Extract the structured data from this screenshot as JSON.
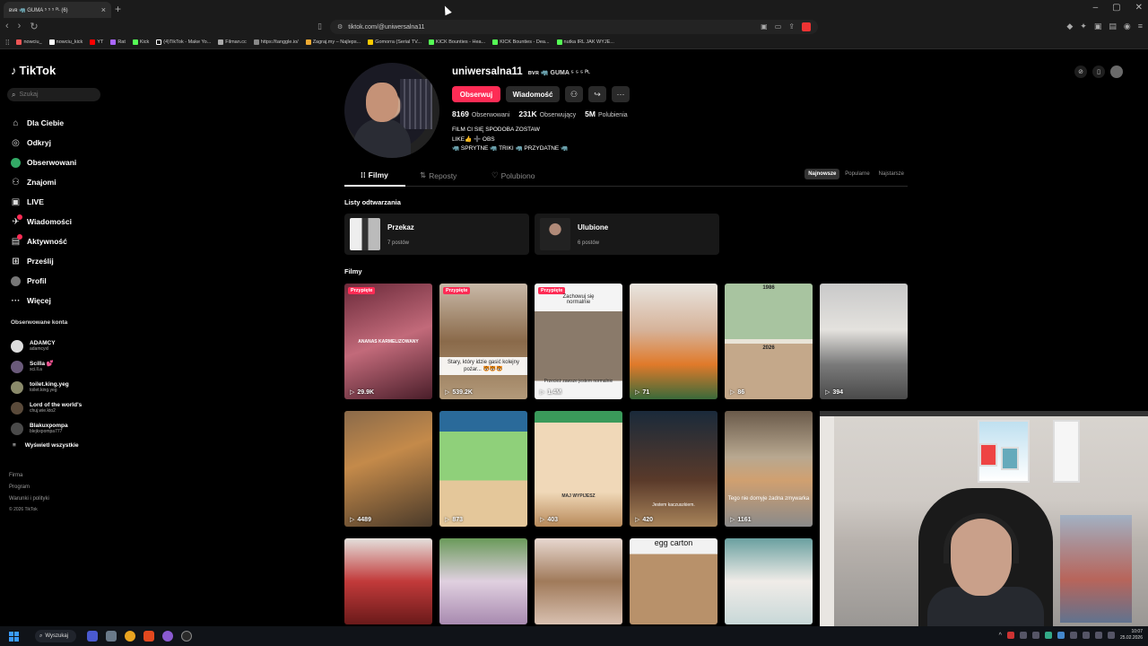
{
  "browser": {
    "tab_title": "ʙᴠʀ 🦏 GUMA ⁵ ⁵ ⁵ ᴾᴸ (6)",
    "url": "tiktok.com/@uniwersalna11",
    "bookmarks": [
      "nowciu_",
      "nowciu_kick",
      "YT",
      "Rat",
      "Kick",
      "(4)TikTok - Make Yo...",
      "Filman.cc",
      "https://tanggle.io/",
      "Zagraj.my – Najleps...",
      "Gomorra (Serial TV...",
      "KICK Bounties - Hea...",
      "KICK Bounties - Dea...",
      "nutka IRL JAK WYJE..."
    ]
  },
  "sidebar": {
    "logo": "TikTok",
    "search_placeholder": "Szukaj",
    "nav": [
      {
        "label": "Dla Ciebie",
        "icon": "home-icon"
      },
      {
        "label": "Odkryj",
        "icon": "compass-icon"
      },
      {
        "label": "Obserwowani",
        "icon": "avatar-icon"
      },
      {
        "label": "Znajomi",
        "icon": "friends-icon"
      },
      {
        "label": "LIVE",
        "icon": "live-icon"
      },
      {
        "label": "Wiadomości",
        "icon": "messages-icon",
        "badge": "12"
      },
      {
        "label": "Aktywność",
        "icon": "inbox-icon"
      },
      {
        "label": "Prześlij",
        "icon": "upload-icon"
      },
      {
        "label": "Profil",
        "icon": "profile-icon"
      },
      {
        "label": "Więcej",
        "icon": "more-icon"
      }
    ],
    "followed_title": "Obserwowane konta",
    "followed": [
      {
        "name": "ADAMCY",
        "handle": "adamcyxl"
      },
      {
        "name": "Scilla 💕",
        "handle": "sci.ll.a"
      },
      {
        "name": "toilet.king.yeg",
        "handle": "toilet.king.yeg"
      },
      {
        "name": "Lord of the world's",
        "handle": "chuj.wie.kto2"
      },
      {
        "name": "Blakuxpompa",
        "handle": "blejkxpompa777"
      }
    ],
    "show_all": "Wyświetl wszystkie",
    "footer": [
      "Firma",
      "Program",
      "Warunki i polityki",
      "© 2026 TikTok"
    ]
  },
  "profile": {
    "username": "uniwersalna11",
    "display_name": "ʙᴠʀ 🦏 GUMA ⁵ ⁵ ⁵ ᴾᴸ",
    "follow_btn": "Obserwuj",
    "message_btn": "Wiadomość",
    "stats": [
      {
        "value": "8169",
        "label": "Obserwowani"
      },
      {
        "value": "231K",
        "label": "Obserwujący"
      },
      {
        "value": "5M",
        "label": "Polubienia"
      }
    ],
    "bio": [
      "FILM CI SIĘ SPODOBA ZOSTAW",
      "LIKE👍 ➕ OBS",
      "🦏 SPRYTNE 🦏 TRIKI 🦏 PRZYDATNE 🦏"
    ]
  },
  "tabs": [
    {
      "label": "Filmy"
    },
    {
      "label": "Reposty"
    },
    {
      "label": "Polubiono"
    }
  ],
  "sort": [
    "Najnowsze",
    "Popularne",
    "Najstarsze"
  ],
  "playlists_title": "Listy odtwarzania",
  "playlists": [
    {
      "title": "Przekaz",
      "count": "7 postów"
    },
    {
      "title": "Ulubione",
      "count": "6 postów"
    }
  ],
  "videos_title": "Filmy",
  "pinned_label": "Przypięte",
  "videos": [
    {
      "views": "29.9K",
      "caption": "",
      "overlay": "ANANAS KARMELIZOWANY"
    },
    {
      "views": "539.2K",
      "caption": "Stary, który idzie gasić kolejny pożar... 🐯🐯🐯"
    },
    {
      "views": "1.4M",
      "caption": "Przecież zawsze jestem normalnie",
      "top_text": "Zachowuj się normalnie"
    },
    {
      "views": "71"
    },
    {
      "views": "86",
      "top_year": "1986",
      "mid_year": "2026"
    },
    {
      "views": "394"
    },
    {
      "views": "4489"
    },
    {
      "views": "873"
    },
    {
      "views": "403",
      "top_text": "MAJ WYPIJESZ"
    },
    {
      "views": "420",
      "top_text": "Jestem kaczuszkiem."
    },
    {
      "views": "1161",
      "caption": "Tego nie domyje żadna zmywarka"
    },
    {
      "views": ""
    },
    {
      "views": ""
    },
    {
      "views": ""
    },
    {
      "views": ""
    },
    {
      "views": "",
      "top_text": "egg carton"
    },
    {
      "views": ""
    }
  ],
  "taskbar": {
    "search": "Wyszukaj",
    "time": "10:07",
    "date": "25.02.2026"
  }
}
